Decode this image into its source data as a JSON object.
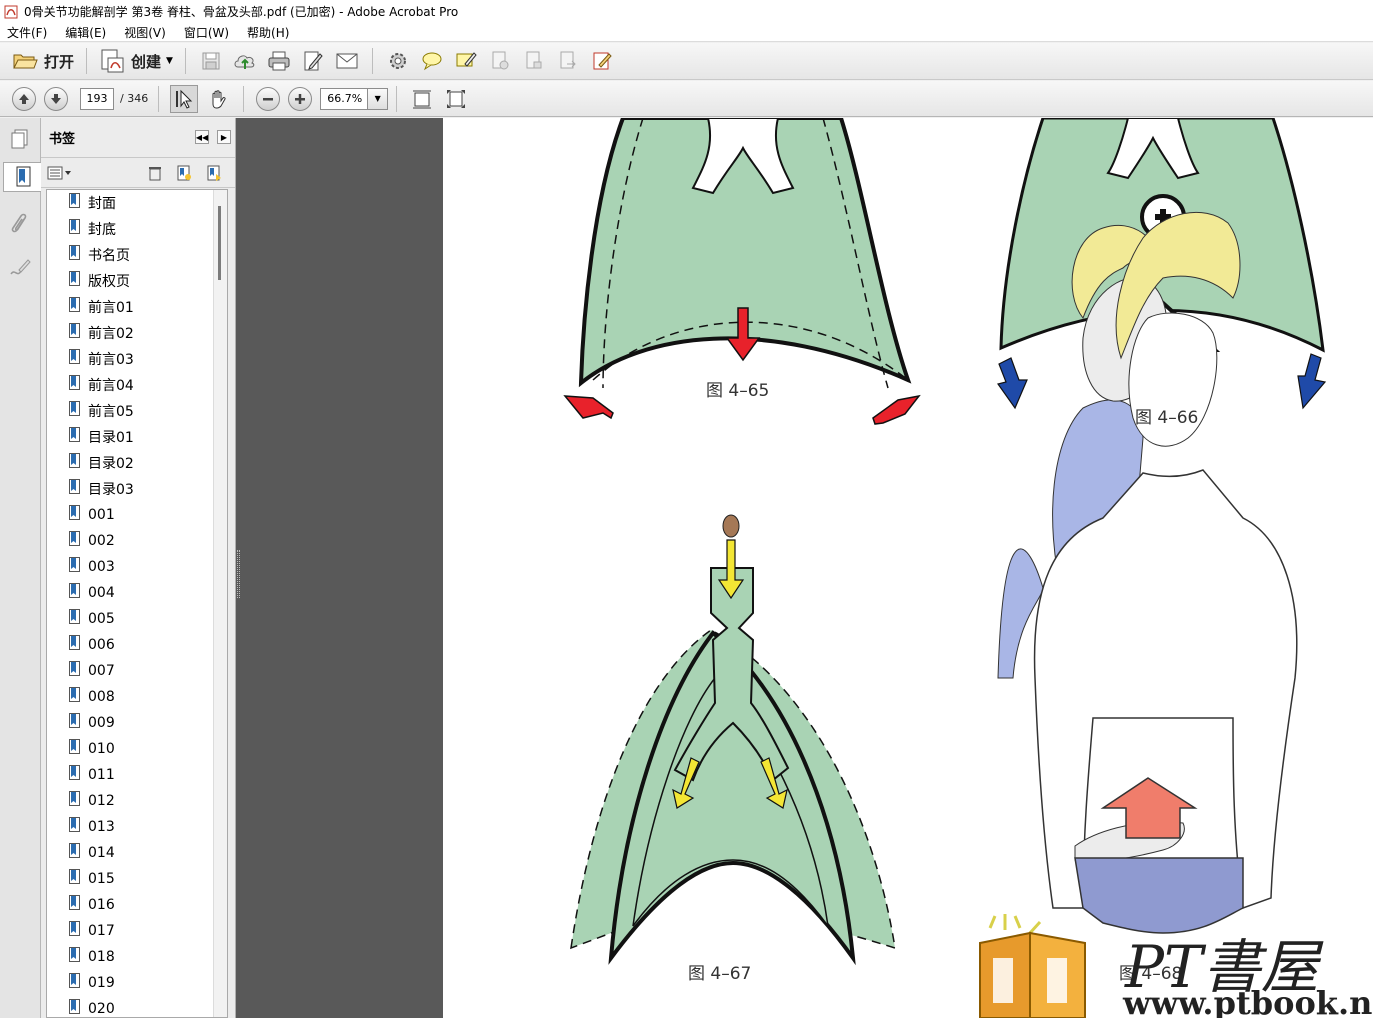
{
  "window": {
    "title": "0骨关节功能解剖学  第3卷  脊柱、骨盆及头部.pdf  (已加密)  - Adobe Acrobat Pro"
  },
  "menu": [
    "文件(F)",
    "编辑(E)",
    "视图(V)",
    "窗口(W)",
    "帮助(H)"
  ],
  "toolbar": {
    "open_label": "打开",
    "create_label": "创建"
  },
  "navigation": {
    "current_page": "193",
    "total_pages": "/ 346",
    "zoom": "66.7%"
  },
  "bookmarks_panel": {
    "title": "书签",
    "items": [
      "封面",
      "封底",
      "书名页",
      "版权页",
      "前言01",
      "前言02",
      "前言03",
      "前言04",
      "前言05",
      "目录01",
      "目录02",
      "目录03",
      "001",
      "002",
      "003",
      "004",
      "005",
      "006",
      "007",
      "008",
      "009",
      "010",
      "011",
      "012",
      "013",
      "014",
      "015",
      "016",
      "017",
      "018",
      "019",
      "020"
    ]
  },
  "document": {
    "captions": {
      "fig65": "图 4–65",
      "fig66": "图 4–66",
      "fig67": "图 4–67",
      "fig68": "图 4–68"
    },
    "watermark": {
      "brand": "PT書屋",
      "url": "www.ptbook.net"
    }
  },
  "colors": {
    "lung_fill": "#a9d3b4",
    "arrow_red": "#e8222b",
    "arrow_blue": "#1f4aa8",
    "arrow_yellow": "#f3e634",
    "arrow_salmon": "#f07d6b",
    "doc_background": "#595959"
  }
}
